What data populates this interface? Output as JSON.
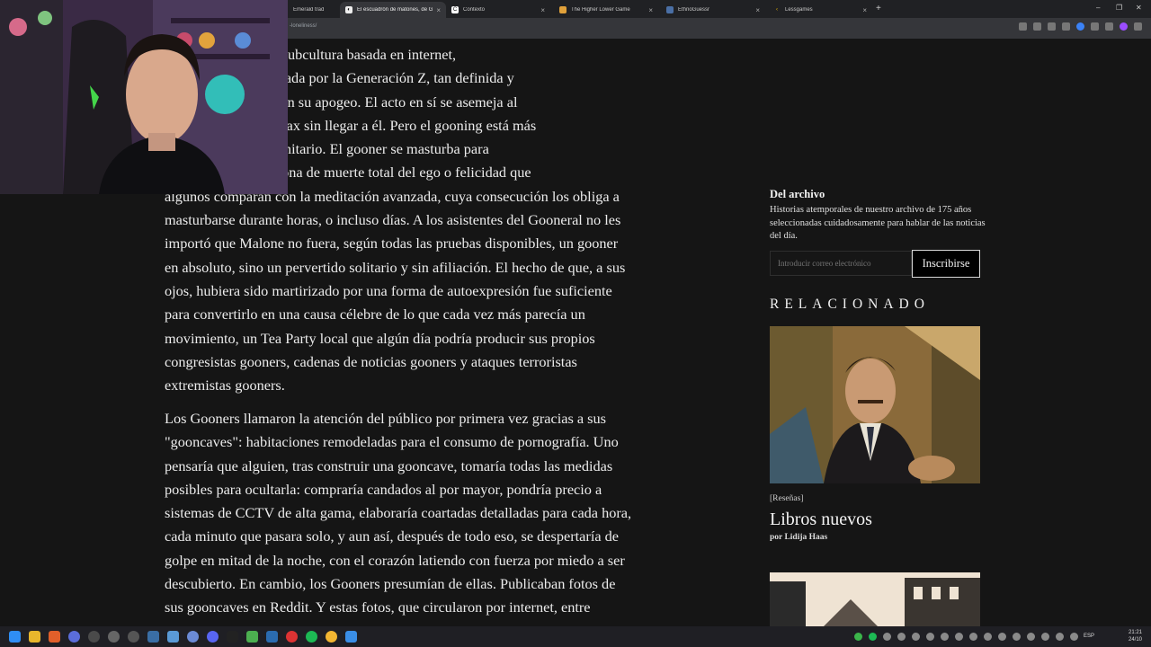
{
  "browser": {
    "tabs": [
      {
        "label": "Emerald trad",
        "active": false
      },
      {
        "label": "El escuadrón de matones, de G",
        "active": true
      },
      {
        "label": "Contexto",
        "active": false
      },
      {
        "label": "The Higher Lower Game",
        "active": false
      },
      {
        "label": "EthnoGuessr",
        "active": false
      },
      {
        "label": "Lessgames",
        "active": false
      }
    ],
    "new_tab": "+",
    "window_controls": [
      "–",
      "❐",
      "✕"
    ],
    "url": "-loneliness/"
  },
  "article": {
    "para1_lines": [
      "n el corazón de una subcultura basada en internet,",
      "pornografía y dominada por la Generación Z, tan definida y",
      "hippies o los punks en su apogeo. El acto en sí se asemeja al",
      "epetidamente al clímax sin llegar a él. Pero el gooning está más",
      "ctivo y es más comunitario. El gooner se masturba para",
      "nte\": una supuesta zona de muerte total del ego o felicidad que",
      "algunos comparan con la meditación avanzada, cuya consecución los obliga a",
      "masturbarse durante horas, o incluso días. A los asistentes del Gooneral no les",
      "importó que Malone no fuera, según todas las pruebas disponibles, un gooner",
      "en absoluto, sino un pervertido solitario y sin afiliación. El hecho de que, a sus",
      "ojos, hubiera sido martirizado por una forma de autoexpresión fue suficiente",
      "para convertirlo en una causa célebre de lo que cada vez más parecía un",
      "movimiento, un Tea Party local que algún día podría producir sus propios",
      "congresistas gooners, cadenas de noticias gooners y ataques terroristas",
      "extremistas gooners."
    ],
    "para2_lines": [
      "Los Gooners llamaron la atención del público por primera vez gracias a sus",
      "\"gooncaves\": habitaciones remodeladas para el consumo de pornografía. Uno",
      "pensaría que alguien, tras construir una gooncave, tomaría todas las medidas",
      "posibles para ocultarla: compraría candados al por mayor, pondría precio a",
      "sistemas de CCTV de alta gama, elaboraría coartadas detalladas para cada hora,",
      "cada minuto que pasara solo, y aun así, después de todo eso, se despertaría de",
      "golpe en mitad de la noche, con el corazón latiendo con fuerza por miedo a ser",
      "descubierto. En cambio, los Gooners presumían de ellas. Publicaban fotos de",
      "sus gooncaves en Reddit. Y estas fotos, que circularon por internet, entre"
    ]
  },
  "sidebar": {
    "archive_title": "Del archivo",
    "archive_desc": "Historias atemporales de nuestro archivo de 175 años seleccionadas cuidadosamente para hablar de las noticias del día.",
    "email_placeholder": "Introducir correo electrónico",
    "subscribe_label": "Inscribirse",
    "related_heading": "RELACIONADO",
    "related_tag": "[Reseñas]",
    "related_title": "Libros nuevos",
    "related_byline": "por Lidija Haas"
  },
  "taskbar": {
    "language": "ESP",
    "time": "21:21",
    "date": "24/10"
  },
  "colors": {
    "page_bg": "#151515",
    "accent_purple": "#9b4dff",
    "tab_bar": "#202124"
  }
}
